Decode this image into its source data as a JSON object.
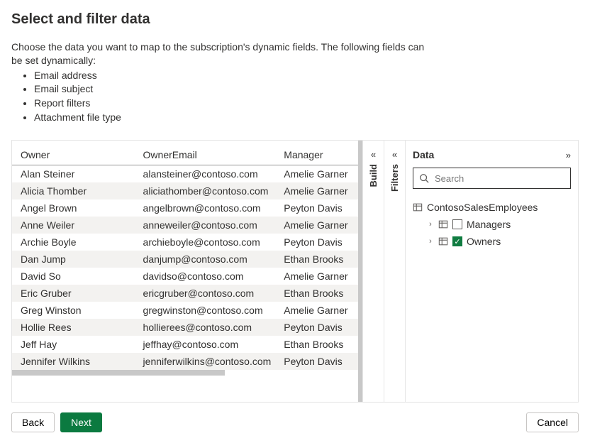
{
  "header": {
    "title": "Select and filter data",
    "intro": "Choose the data you want to map to the subscription's dynamic fields. The following fields can be set dynamically:",
    "bullets": [
      "Email address",
      "Email subject",
      "Report filters",
      "Attachment file type"
    ]
  },
  "table": {
    "columns": [
      "Owner",
      "OwnerEmail",
      "Manager"
    ],
    "rows": [
      {
        "owner": "Alan Steiner",
        "email": "alansteiner@contoso.com",
        "manager": "Amelie Garner"
      },
      {
        "owner": "Alicia Thomber",
        "email": "aliciathomber@contoso.com",
        "manager": "Amelie Garner"
      },
      {
        "owner": "Angel Brown",
        "email": "angelbrown@contoso.com",
        "manager": "Peyton Davis"
      },
      {
        "owner": "Anne Weiler",
        "email": "anneweiler@contoso.com",
        "manager": "Amelie Garner"
      },
      {
        "owner": "Archie Boyle",
        "email": "archieboyle@contoso.com",
        "manager": "Peyton Davis"
      },
      {
        "owner": "Dan Jump",
        "email": "danjump@contoso.com",
        "manager": "Ethan Brooks"
      },
      {
        "owner": "David So",
        "email": "davidso@contoso.com",
        "manager": "Amelie Garner"
      },
      {
        "owner": "Eric Gruber",
        "email": "ericgruber@contoso.com",
        "manager": "Ethan Brooks"
      },
      {
        "owner": "Greg Winston",
        "email": "gregwinston@contoso.com",
        "manager": "Amelie Garner"
      },
      {
        "owner": "Hollie Rees",
        "email": "hollierees@contoso.com",
        "manager": "Peyton Davis"
      },
      {
        "owner": "Jeff Hay",
        "email": "jeffhay@contoso.com",
        "manager": "Ethan Brooks"
      },
      {
        "owner": "Jennifer Wilkins",
        "email": "jenniferwilkins@contoso.com",
        "manager": "Peyton Davis"
      }
    ]
  },
  "rails": {
    "build": "Build",
    "filters": "Filters"
  },
  "dataPanel": {
    "title": "Data",
    "searchPlaceholder": "Search",
    "datasource": "ContosoSalesEmployees",
    "nodes": [
      {
        "label": "Managers",
        "checked": false
      },
      {
        "label": "Owners",
        "checked": true
      }
    ]
  },
  "footer": {
    "back": "Back",
    "next": "Next",
    "cancel": "Cancel"
  }
}
